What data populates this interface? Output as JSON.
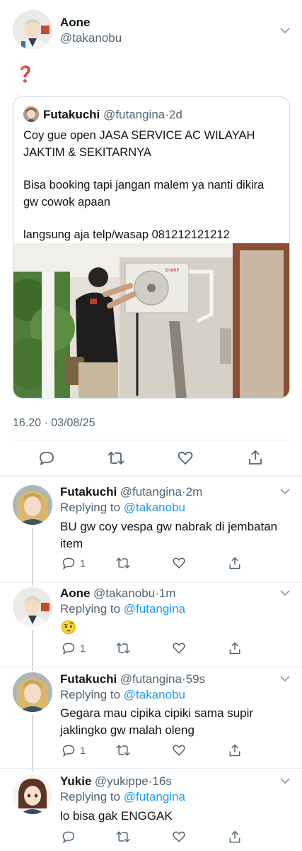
{
  "main_tweet": {
    "name": "Aone",
    "handle": "@takanobu",
    "text": "❓",
    "timestamp": "16.20 · 03/08/25",
    "quoted": {
      "name": "Futakuchi",
      "handle": "@futangina",
      "age": "2d",
      "line1": "Coy gue open JASA SERVICE AC WILAYAH",
      "line2": "JAKTIM & SEKITARNYA",
      "line3": "Bisa booking tapi jangan malem ya nanti dikira",
      "line4": "gw cowok apaan",
      "line5": "langsung aja telp/wasap 081212121212",
      "brand_on_ac": "SHARP"
    }
  },
  "replies": [
    {
      "name": "Futakuchi",
      "handle": "@futangina",
      "age": "2m",
      "replying_label": "Replying to",
      "replying_to": "@takanobu",
      "line1": "BU gw coy vespa gw nabrak di jembatan",
      "line2": "item",
      "reply_count": "1"
    },
    {
      "name": "Aone",
      "handle": "@takanobu",
      "age": "1m",
      "replying_label": "Replying to",
      "replying_to": "@futangina",
      "line1": "🤨",
      "line2": "",
      "reply_count": "1"
    },
    {
      "name": "Futakuchi",
      "handle": "@futangina",
      "age": "59s",
      "replying_label": "Replying to",
      "replying_to": "@takanobu",
      "line1": "Gegara mau cipika cipiki sama supir",
      "line2": "jaklingko gw malah oleng",
      "reply_count": "1"
    },
    {
      "name": "Yukie",
      "handle": "@yukippe",
      "age": "16s",
      "replying_label": "Replying to",
      "replying_to": "@futangina",
      "line1": "lo bisa gak ENGGAK",
      "line2": "",
      "reply_count": ""
    }
  ],
  "colors": {
    "accent": "#1d9bf0",
    "muted": "#536471",
    "divider": "#e6ecf0",
    "question_mark": "#e0245e"
  }
}
